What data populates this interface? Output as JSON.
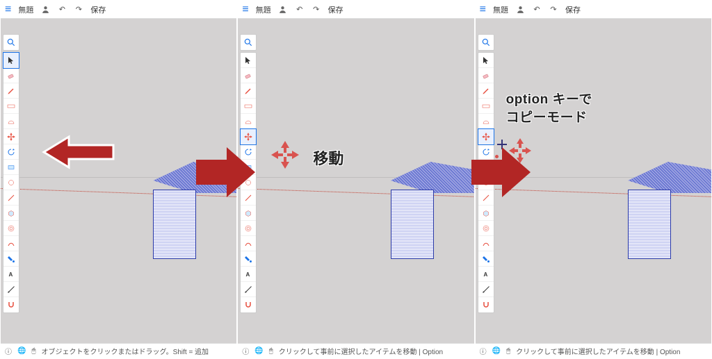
{
  "topbar": {
    "title": "無題",
    "save": "保存"
  },
  "status": {
    "p1": "オブジェクトをクリックまたはドラッグ。Shift = 追加",
    "p2": "クリックして事前に選択したアイテムを移動 | Option",
    "p3": "クリックして事前に選択したアイテムを移動 | Option"
  },
  "annot": {
    "move": "移動",
    "copy1": "option キーで",
    "copy2": "コピーモード"
  },
  "icons": {
    "search": "🔍",
    "select": "▲",
    "eraser": "🧽",
    "pencil": "✏️",
    "ruler": "📐",
    "protractor": "◔",
    "move": "✥",
    "rotate": "↻",
    "rect": "▭",
    "circle": "◯",
    "line": "⟋",
    "push": "⬛",
    "offset": "⊚",
    "follow": "↝",
    "paint": "🪣",
    "text": "𝐀",
    "tape": "📏",
    "magnet": "🧲",
    "help": "?",
    "globe": "🌐",
    "mouse": "🖱"
  },
  "tool_order": [
    "select",
    "eraser",
    "pencil",
    "ruler",
    "protractor",
    "move",
    "rotate",
    "rect",
    "circle",
    "line",
    "push",
    "offset",
    "follow",
    "paint",
    "text",
    "tape",
    "magnet"
  ],
  "active": {
    "p1": "select",
    "p2": "move",
    "p3": "move"
  }
}
